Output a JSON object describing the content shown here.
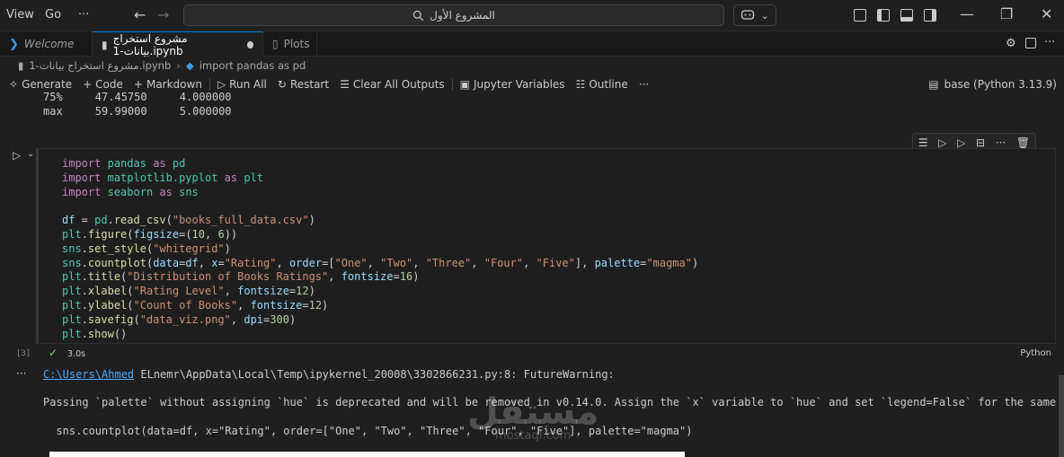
{
  "menu": {
    "view": "View",
    "go": "Go",
    "more": "···"
  },
  "nav": {
    "back": "←",
    "forward": "→"
  },
  "search": {
    "icon": "search-icon",
    "text": "المشروع الأول"
  },
  "copilot": {
    "icon": "copilot-icon",
    "chevron": "⌄"
  },
  "tabs": [
    {
      "label": "Welcome",
      "icon": "vscode-icon"
    },
    {
      "label": "مشروع استخراج بيانات-1.ipynb",
      "icon": "notebook-icon",
      "modified": true
    },
    {
      "label": "Plots",
      "icon": "plots-icon"
    }
  ],
  "breadcrumb": {
    "file": "مشروع استخراج بيانات-1.ipynb",
    "cell": "import pandas as pd"
  },
  "toolbar": {
    "generate": "Generate",
    "code": "Code",
    "markdown": "Markdown",
    "run_all": "Run All",
    "restart": "Restart",
    "clear_outputs": "Clear All Outputs",
    "variables": "Jupyter Variables",
    "outline": "Outline",
    "more": "···",
    "kernel": "base (Python 3.13.9)"
  },
  "prev_output": {
    "row1": "75%     47.45750     4.000000",
    "row2": "max     59.99000     5.000000"
  },
  "cell": {
    "lines": [
      {
        "kw1": "import",
        "mod": "pandas",
        "kw2": "as",
        "alias": "pd"
      },
      {
        "kw1": "import",
        "mod": "matplotlib.pyplot",
        "kw2": "as",
        "alias": "plt"
      },
      {
        "kw1": "import",
        "mod": "seaborn",
        "kw2": "as",
        "alias": "sns"
      }
    ],
    "l_df": {
      "var": "df",
      "eq": " = ",
      "obj": "pd",
      "fn": "read_csv",
      "arg": "\"books_full_data.csv\""
    },
    "l_fig": {
      "obj": "plt",
      "fn": "figure",
      "kw": "figsize",
      "val1": "10",
      "val2": "6"
    },
    "l_style": {
      "obj": "sns",
      "fn": "set_style",
      "arg": "\"whitegrid\""
    },
    "l_count": {
      "obj": "sns",
      "fn": "countplot",
      "k1": "data",
      "v1": "df",
      "k2": "x",
      "v2": "\"Rating\"",
      "k3": "order",
      "o1": "\"One\"",
      "o2": "\"Two\"",
      "o3": "\"Three\"",
      "o4": "\"Four\"",
      "o5": "\"Five\"",
      "k4": "palette",
      "v4": "\"magma\""
    },
    "l_title": {
      "obj": "plt",
      "fn": "title",
      "arg": "\"Distribution of Books Ratings\"",
      "k": "fontsize",
      "v": "16"
    },
    "l_xlabel": {
      "obj": "plt",
      "fn": "xlabel",
      "arg": "\"Rating Level\"",
      "k": "fontsize",
      "v": "12"
    },
    "l_ylabel": {
      "obj": "plt",
      "fn": "ylabel",
      "arg": "\"Count of Books\"",
      "k": "fontsize",
      "v": "12"
    },
    "l_save": {
      "obj": "plt",
      "fn": "savefig",
      "arg": "\"data_viz.png\"",
      "k": "dpi",
      "v": "300"
    },
    "l_show": {
      "obj": "plt",
      "fn": "show"
    },
    "exec_count": "[3]",
    "exec_time": "3.0s",
    "language": "Python"
  },
  "output": {
    "ellipsis": "···",
    "path_link": "C:\\Users\\Ahmed",
    "path_rest": " ELnemr\\AppData\\Local\\Temp\\ipykernel_20008\\3302866231.py:8: FutureWarning:",
    "warning": "Passing `palette` without assigning `hue` is deprecated and will be removed in v0.14.0. Assign the `x` variable to `hue` and set `legend=False` for the same effect.",
    "code_echo": "  sns.countplot(data=df, x=\"Rating\", order=[\"One\", \"Two\", \"Three\", \"Four\", \"Five\"], palette=\"magma\")"
  },
  "watermark": {
    "arabic": "مستقل",
    "latin": "mostaql.com"
  }
}
